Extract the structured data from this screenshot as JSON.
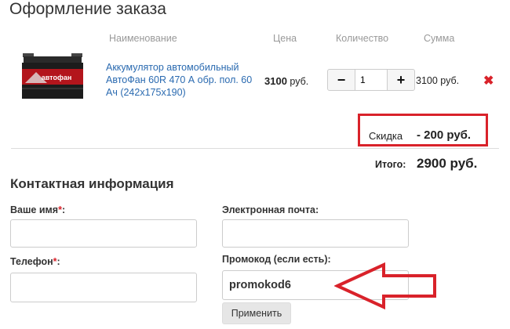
{
  "page_title": "Оформление заказа",
  "table_headers": {
    "name": "Наименование",
    "price": "Цена",
    "quantity": "Количество",
    "sum": "Сумма"
  },
  "product": {
    "name": "Аккумулятор автомобильный АвтоФан 60R 470 А обр. пол. 60 Ач (242x175x190)",
    "image_brand": "автофан",
    "price_value": "3100",
    "price_currency": " руб.",
    "quantity": "1",
    "sum": "3100 руб."
  },
  "qty_controls": {
    "minus": "−",
    "plus": "+"
  },
  "remove_glyph": "✖",
  "discount": {
    "label": "Скидка",
    "value": "- 200 руб."
  },
  "total": {
    "label": "Итого:",
    "value": "2900 руб."
  },
  "contact": {
    "title": "Контактная информация",
    "name_label": "Ваше имя",
    "phone_label": "Телефон",
    "email_label": "Электронная почта:",
    "promo_label": "Промокод (если есть):",
    "required_mark": "*",
    "colon": ":",
    "name_value": "",
    "phone_value": "",
    "email_value": "",
    "promo_value": "promokod6",
    "apply_label": "Применить"
  },
  "colors": {
    "accent_red": "#d9222a",
    "link_blue": "#2a6ab0"
  },
  "icons": {
    "remove": "close-icon",
    "annotation": "arrow-left-icon"
  }
}
